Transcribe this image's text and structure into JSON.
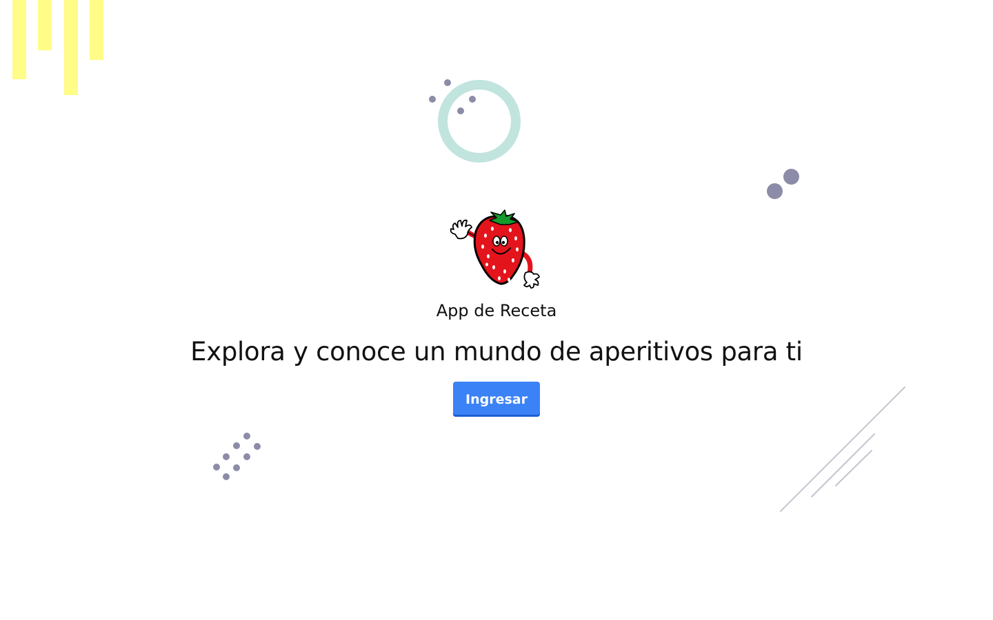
{
  "hero": {
    "app_name": "App de Receta",
    "headline": "Explora y conoce un mundo de aperitivos para ti",
    "cta_label": "Ingresar"
  },
  "logo": {
    "icon": "strawberry-mascot-icon"
  },
  "colors": {
    "background": "#ffffff",
    "accent_button": "#3b82f6",
    "accent_button_shadow": "#1e5fcf",
    "deco_yellow": "#fffc87",
    "deco_ring": "#c1e4de",
    "deco_dots": "#8c8ca8",
    "deco_lines": "#c4c4d0",
    "strawberry_red": "#e4141c",
    "leaf_green": "#159a2c"
  }
}
